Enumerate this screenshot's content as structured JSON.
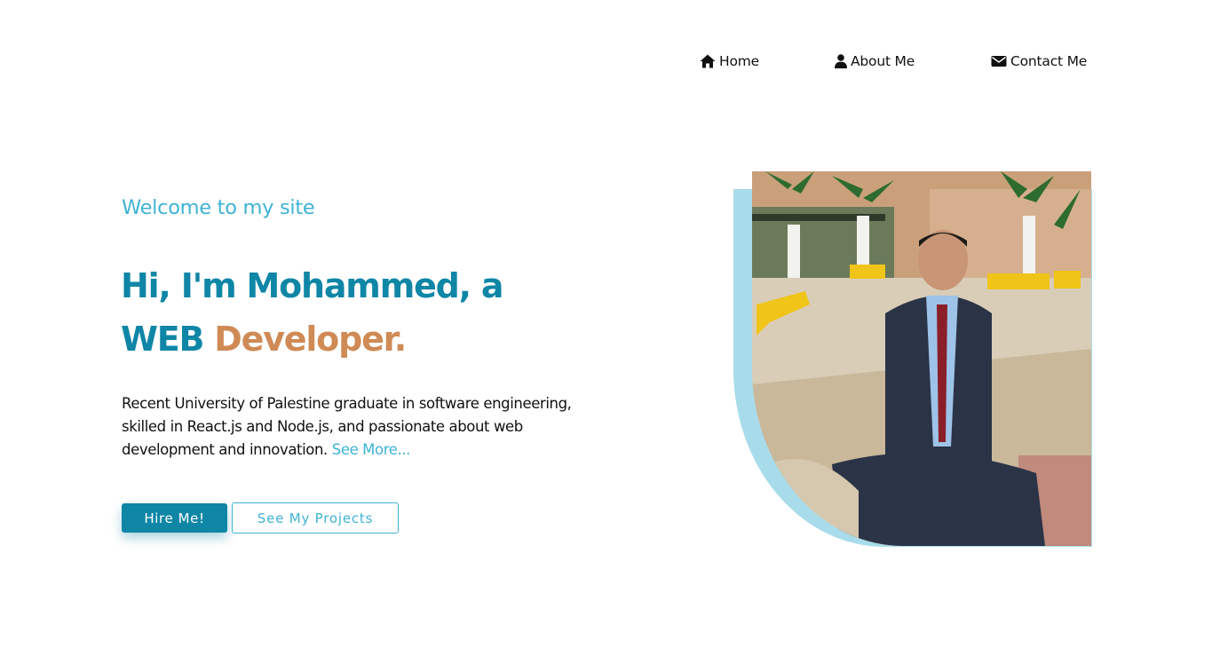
{
  "nav": {
    "items": [
      {
        "label": "Home",
        "icon": "home-icon"
      },
      {
        "label": "About Me",
        "icon": "user-icon"
      },
      {
        "label": "Contact Me",
        "icon": "envelope-icon"
      }
    ]
  },
  "hero": {
    "welcome": "Welcome to my site",
    "headline_line1": "Hi, I'm Mohammed, a",
    "headline_line2_a": "WEB",
    "headline_line2_b": "Developer.",
    "intro": "Recent University of Palestine graduate in software engineering, skilled in React.js and Node.js, and passionate about web development and innovation.",
    "see_more": "See More...",
    "hire_button": "Hire Me!",
    "projects_button": "See My Projects"
  },
  "colors": {
    "primary": "#0f86a6",
    "light_accent": "#3fb3d4",
    "orange_accent": "#cf8a55",
    "photo_backdrop": "#a8dceb"
  }
}
